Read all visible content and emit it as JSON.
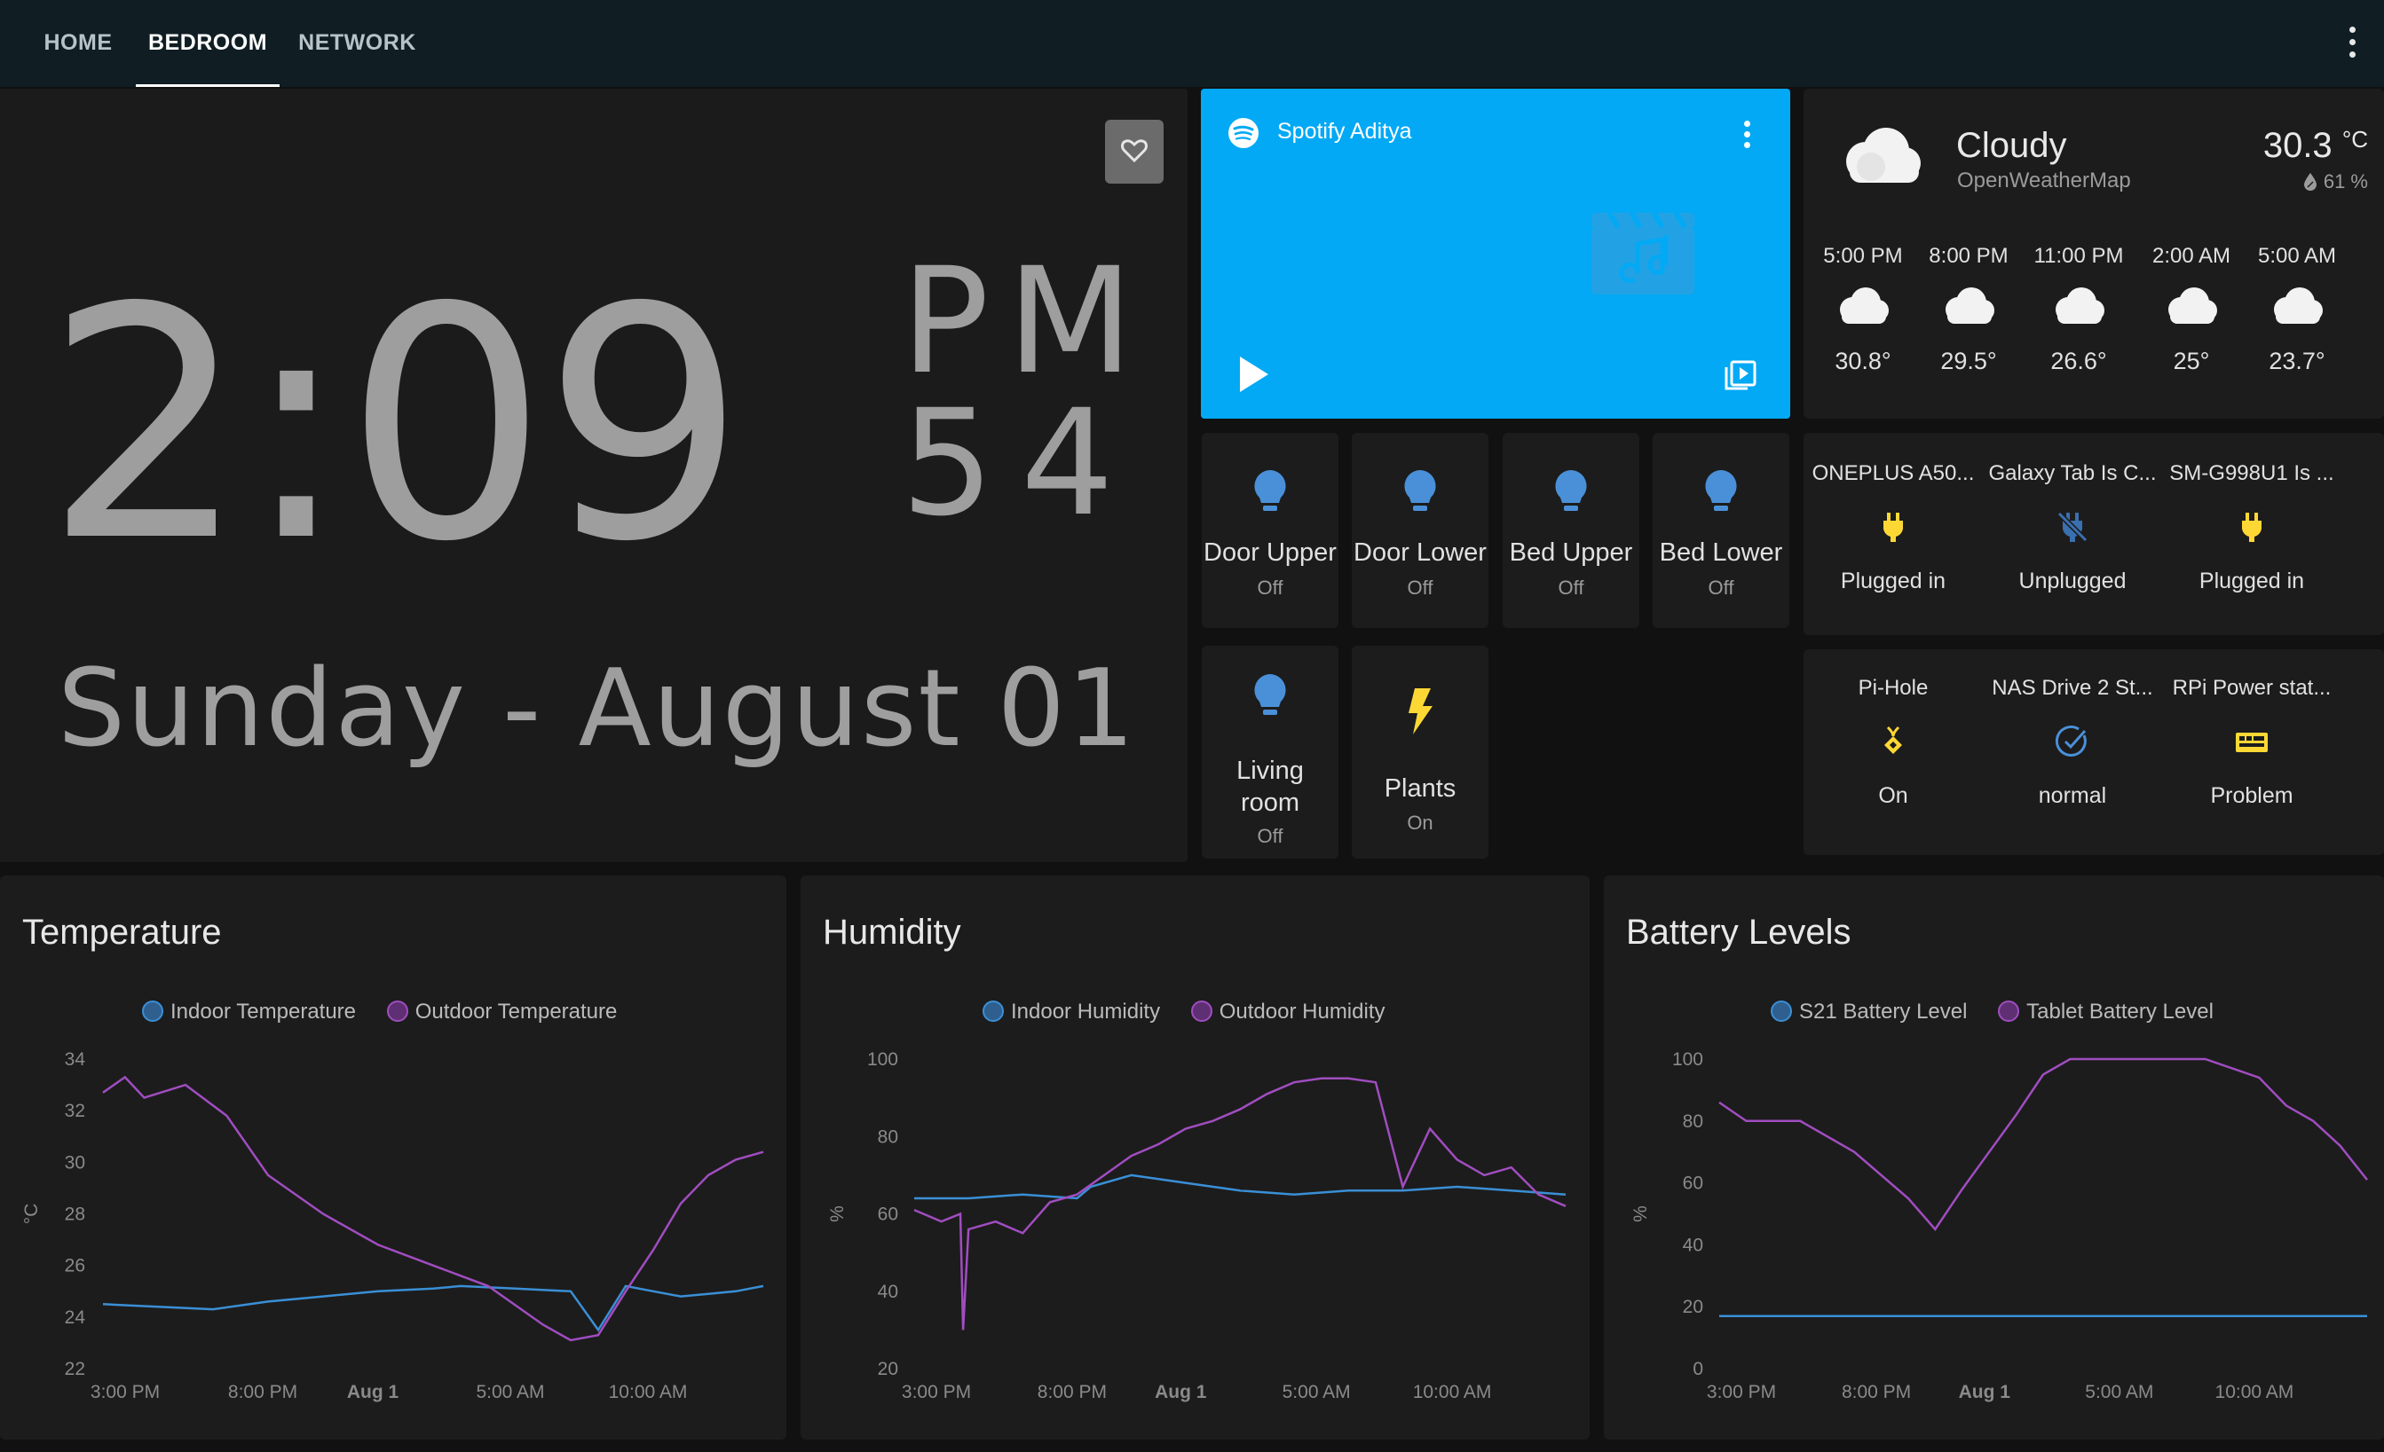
{
  "tabs": [
    {
      "label": "HOME"
    },
    {
      "label": "BEDROOM"
    },
    {
      "label": "NETWORK"
    }
  ],
  "clock": {
    "time": "2:09",
    "ampm": "PM",
    "seconds": "54",
    "date": "Sunday - August 01"
  },
  "media": {
    "title": "Spotify Aditya"
  },
  "lights": [
    {
      "name": "Door Upper",
      "state": "Off"
    },
    {
      "name": "Door Lower",
      "state": "Off"
    },
    {
      "name": "Bed Upper",
      "state": "Off"
    },
    {
      "name": "Bed Lower",
      "state": "Off"
    },
    {
      "name": "Living room",
      "state": "Off"
    },
    {
      "name": "Plants",
      "state": "On"
    }
  ],
  "weather": {
    "condition": "Cloudy",
    "source": "OpenWeatherMap",
    "temperature": "30.3",
    "unit": "°C",
    "humidity": "61 %",
    "forecast": [
      {
        "time": "5:00 PM",
        "temp": "30.8°"
      },
      {
        "time": "8:00 PM",
        "temp": "29.5°"
      },
      {
        "time": "11:00 PM",
        "temp": "26.6°"
      },
      {
        "time": "2:00 AM",
        "temp": "25°"
      },
      {
        "time": "5:00 AM",
        "temp": "23.7°"
      }
    ]
  },
  "chargers": [
    {
      "name": "ONEPLUS A50...",
      "state": "Plugged in"
    },
    {
      "name": "Galaxy Tab Is C...",
      "state": "Unplugged"
    },
    {
      "name": "SM-G998U1 Is ...",
      "state": "Plugged in"
    }
  ],
  "services": [
    {
      "name": "Pi-Hole",
      "state": "On"
    },
    {
      "name": "NAS Drive 2 St...",
      "state": "normal"
    },
    {
      "name": "RPi Power stat...",
      "state": "Problem"
    }
  ],
  "colors": {
    "indoor": "#3a8fd6",
    "outdoor": "#a04dc0",
    "spotify": "#03a9f4",
    "bulb": "#4a90d9",
    "bolt": "#fdd835"
  },
  "chart_data": [
    {
      "type": "line",
      "title": "Temperature",
      "ylabel": "°C",
      "ylim": [
        22,
        34
      ],
      "yticks": [
        "34",
        "32",
        "30",
        "28",
        "26",
        "24",
        "22"
      ],
      "xticks": [
        "3:00 PM",
        "8:00 PM",
        "Aug 1",
        "5:00 AM",
        "10:00 AM"
      ],
      "series": [
        {
          "name": "Indoor Temperature",
          "x_hours": [
            0,
            2,
            4,
            6,
            8,
            10,
            12,
            13,
            15,
            17,
            18,
            19,
            20,
            21,
            22,
            23,
            24
          ],
          "values": [
            24.5,
            24.4,
            24.3,
            24.6,
            24.8,
            25.0,
            25.1,
            25.2,
            25.1,
            25.0,
            23.5,
            25.2,
            25.0,
            24.8,
            24.9,
            25.0,
            25.2
          ]
        },
        {
          "name": "Outdoor Temperature",
          "x_hours": [
            0,
            0.8,
            1.5,
            3,
            4.5,
            6,
            8,
            10,
            12,
            14,
            16,
            17,
            18,
            19,
            20,
            21,
            22,
            23,
            24
          ],
          "values": [
            32.7,
            33.3,
            32.5,
            33.0,
            31.8,
            29.5,
            28.0,
            26.8,
            26.0,
            25.2,
            23.7,
            23.1,
            23.3,
            25.0,
            26.6,
            28.4,
            29.5,
            30.1,
            30.4
          ]
        }
      ]
    },
    {
      "type": "line",
      "title": "Humidity",
      "ylabel": "%",
      "ylim": [
        20,
        100
      ],
      "yticks": [
        "100",
        "80",
        "60",
        "40",
        "20"
      ],
      "xticks": [
        "3:00 PM",
        "8:00 PM",
        "Aug 1",
        "5:00 AM",
        "10:00 AM"
      ],
      "series": [
        {
          "name": "Indoor Humidity",
          "x_hours": [
            0,
            2,
            4,
            6,
            6.5,
            8,
            10,
            12,
            14,
            16,
            18,
            20,
            22,
            24
          ],
          "values": [
            64,
            64,
            65,
            64,
            67,
            70,
            68,
            66,
            65,
            66,
            66,
            67,
            66,
            65
          ]
        },
        {
          "name": "Outdoor Humidity",
          "x_hours": [
            0,
            1,
            1.7,
            1.8,
            2,
            3,
            4,
            5,
            6,
            7,
            8,
            9,
            10,
            11,
            12,
            13,
            14,
            15,
            16,
            17,
            18,
            19,
            20,
            21,
            22,
            23,
            24
          ],
          "values": [
            61,
            58,
            60,
            30,
            56,
            58,
            55,
            63,
            65,
            70,
            75,
            78,
            82,
            84,
            87,
            91,
            94,
            95,
            95,
            94,
            67,
            82,
            74,
            70,
            72,
            65,
            62
          ]
        }
      ]
    },
    {
      "type": "line",
      "title": "Battery Levels",
      "ylabel": "%",
      "ylim": [
        0,
        100
      ],
      "yticks": [
        "100",
        "80",
        "60",
        "40",
        "20",
        "0"
      ],
      "xticks": [
        "3:00 PM",
        "8:00 PM",
        "Aug 1",
        "5:00 AM",
        "10:00 AM"
      ],
      "series": [
        {
          "name": "S21 Battery Level",
          "x_hours": [
            0,
            24
          ],
          "values": [
            17,
            17
          ]
        },
        {
          "name": "Tablet Battery Level",
          "x_hours": [
            0,
            1,
            3,
            5,
            7,
            8,
            9,
            10,
            11,
            12,
            13,
            14,
            15,
            16,
            17,
            18,
            20,
            21,
            22,
            23,
            24
          ],
          "values": [
            86,
            80,
            80,
            70,
            55,
            45,
            58,
            70,
            82,
            95,
            100,
            100,
            100,
            100,
            100,
            100,
            94,
            85,
            80,
            72,
            61
          ]
        }
      ]
    }
  ]
}
